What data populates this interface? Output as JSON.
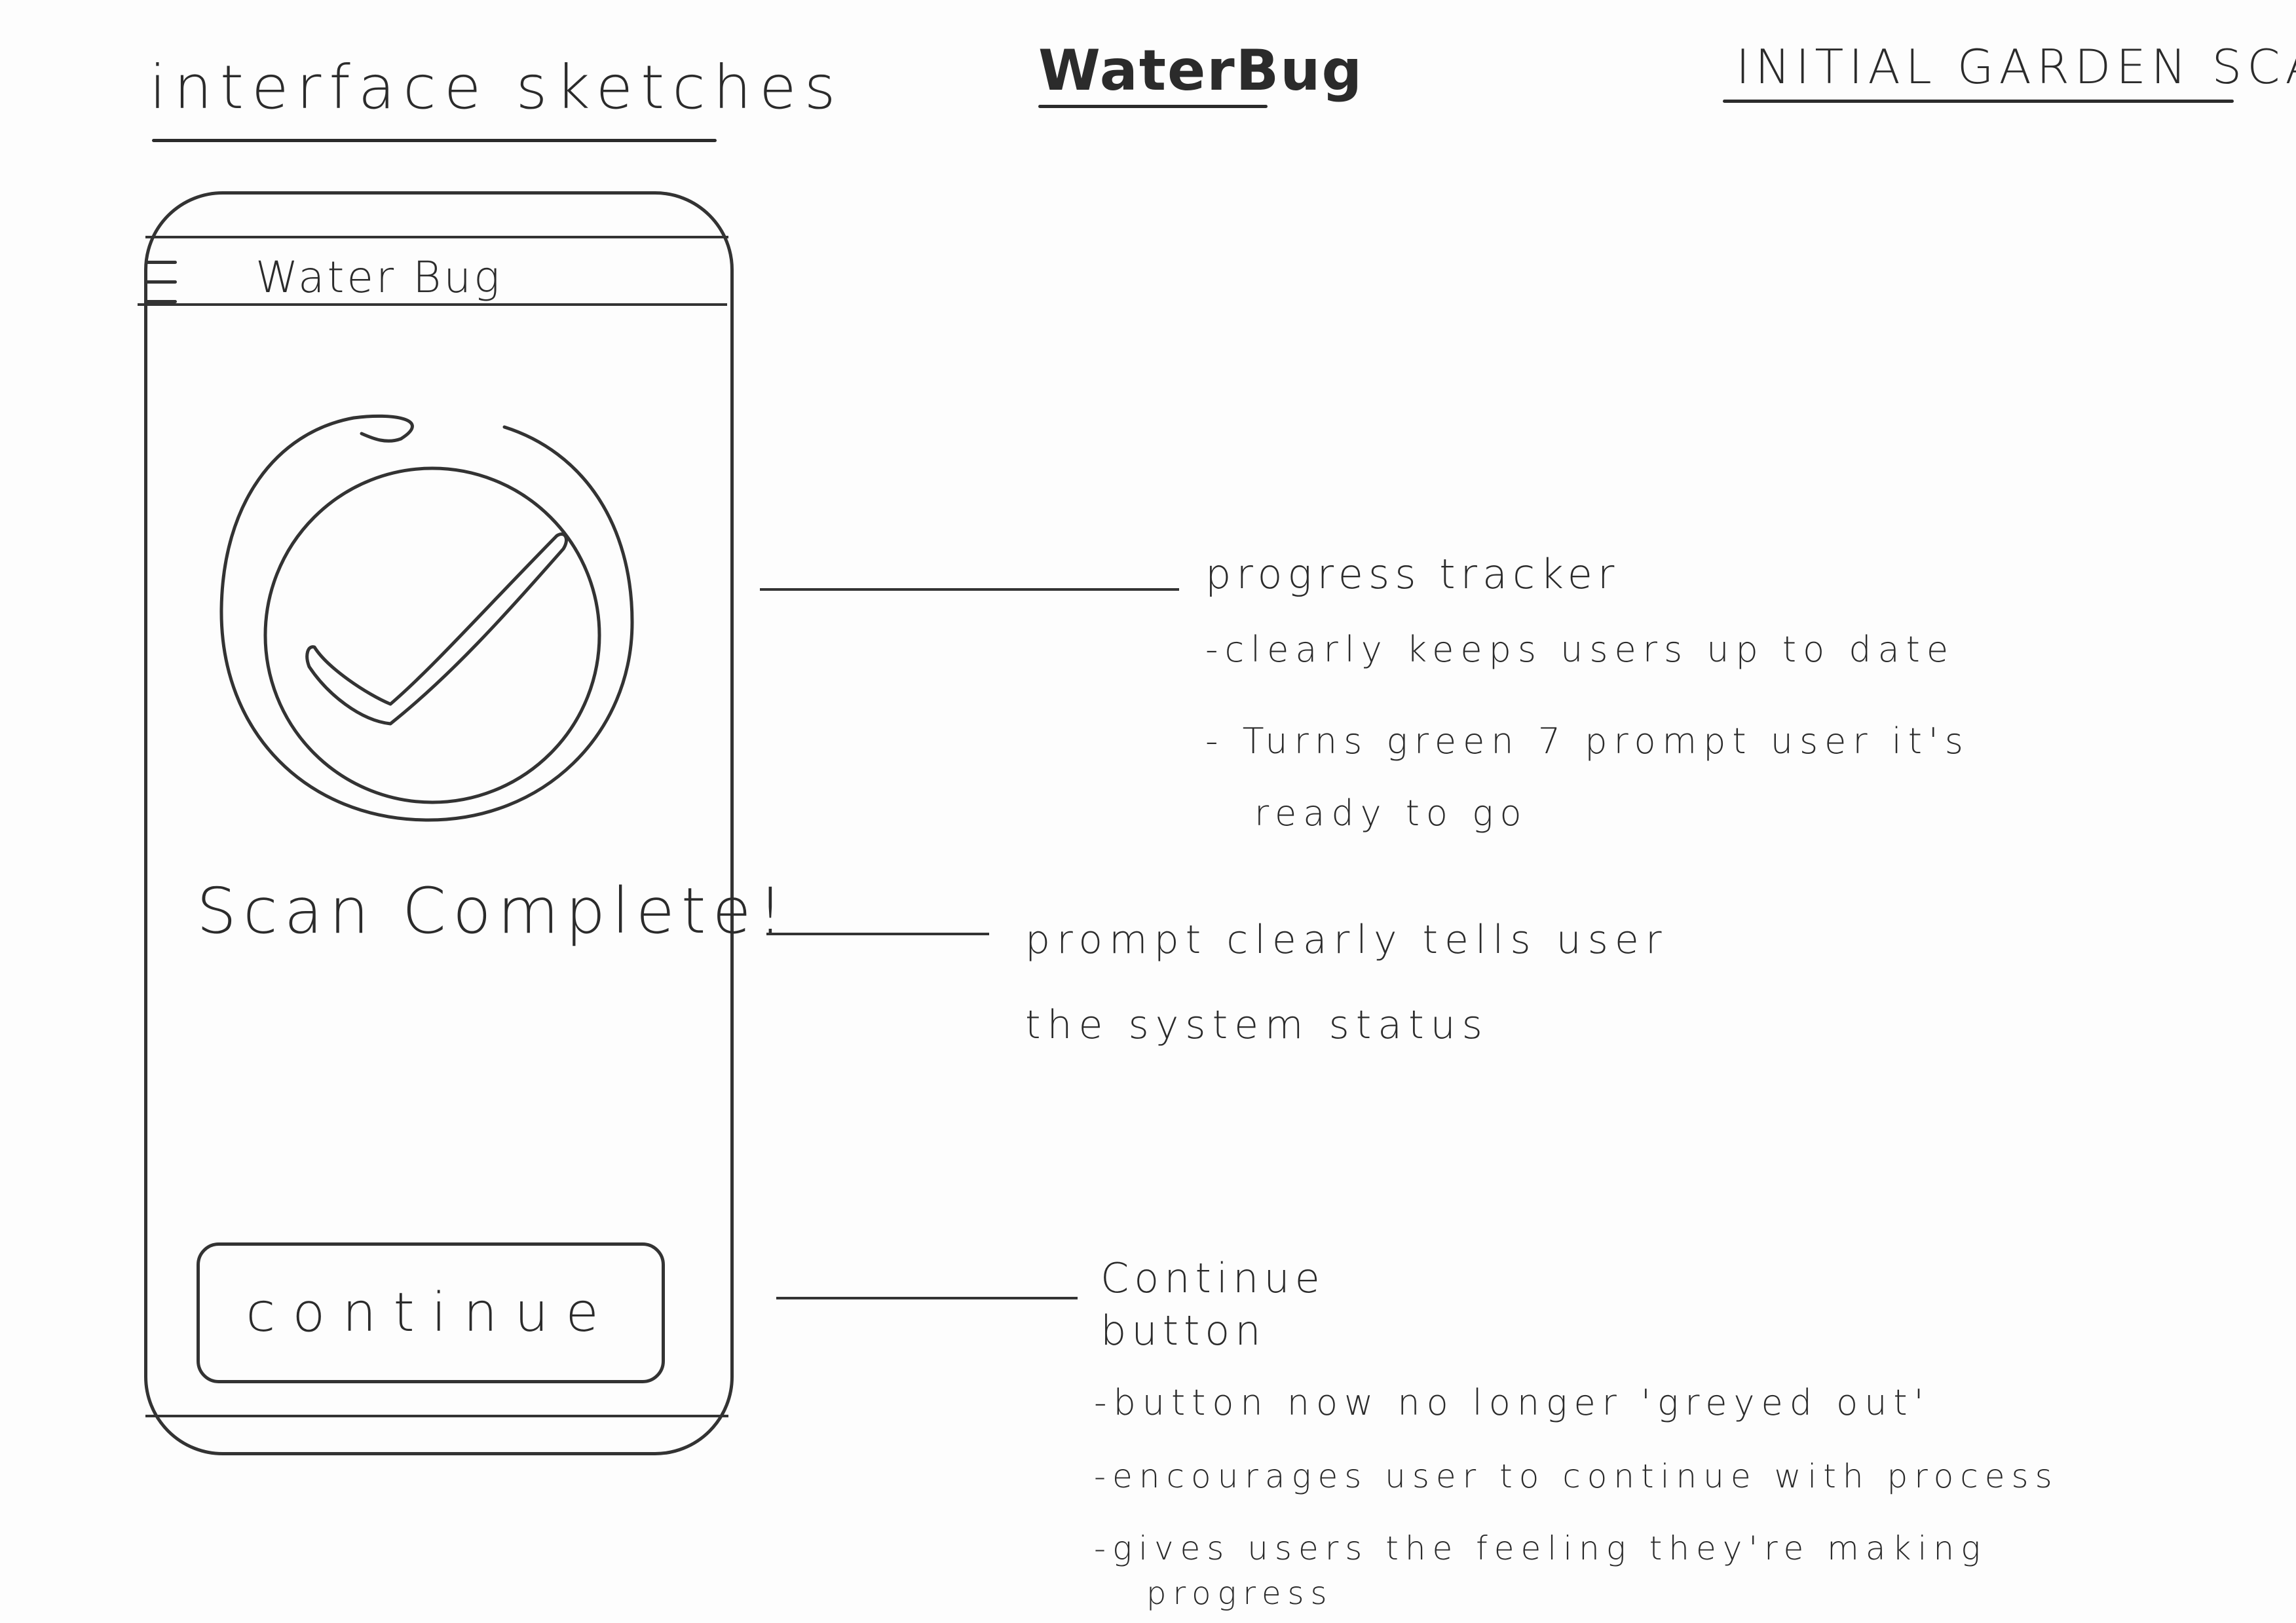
{
  "header": {
    "left": "interface sketches",
    "center": "WaterBug",
    "right": "INITIAL GARDEN SCAN"
  },
  "app": {
    "title": "Water Bug",
    "menu_icon": "hamburger-menu-icon",
    "progress_icon": "check-circle-icon",
    "scan_status": "Scan Complete!",
    "continue_label": "continue"
  },
  "annotations": {
    "progress": {
      "title": "progress tracker",
      "lines": [
        "-clearly keeps users up to date",
        "- Turns green 7 prompt user it's",
        "ready to go"
      ]
    },
    "prompt": {
      "lines": [
        "prompt clearly tells user",
        "the system status"
      ]
    },
    "continue": {
      "title": [
        "Continue",
        "button"
      ],
      "lines": [
        "-button now no longer 'greyed out'",
        "-encourages user to continue with process",
        "-gives users the feeling they're making",
        "progress"
      ]
    }
  }
}
